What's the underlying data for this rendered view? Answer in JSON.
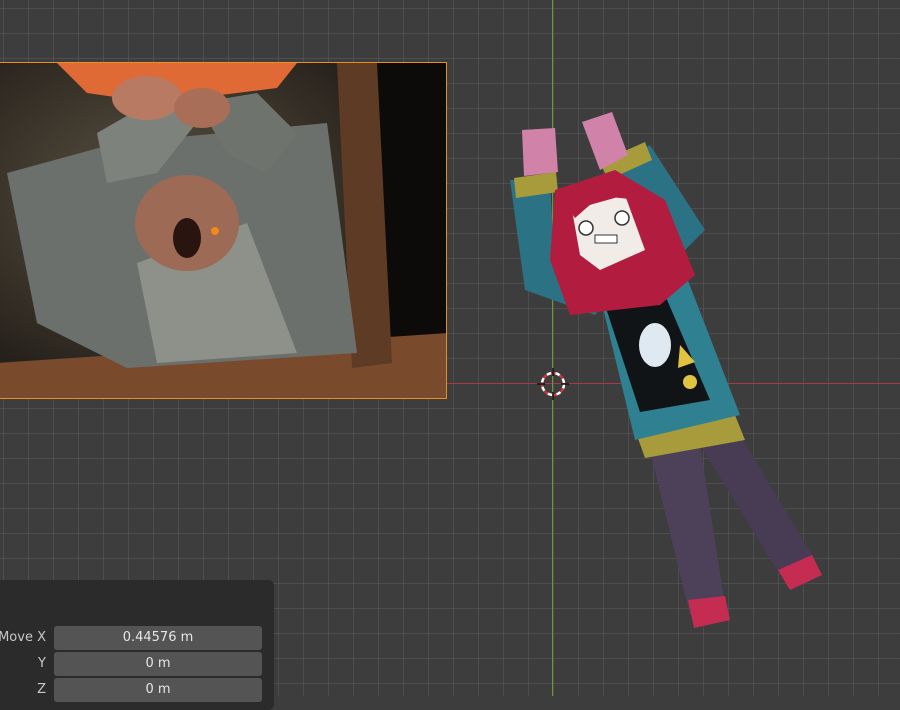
{
  "viewport": {
    "colors": {
      "background": "#3d3d3d",
      "x_axis": "#a8394c",
      "y_axis": "#6d9a2b",
      "selection": "#e8901f"
    }
  },
  "reference_image": {
    "icon": "reference-photo"
  },
  "character": {
    "icon": "cartoon-girl-model"
  },
  "operator_panel": {
    "fields": [
      {
        "label": "Move X",
        "value": "0.44576 m"
      },
      {
        "label": "Y",
        "value": "0 m"
      },
      {
        "label": "Z",
        "value": "0 m"
      }
    ]
  }
}
